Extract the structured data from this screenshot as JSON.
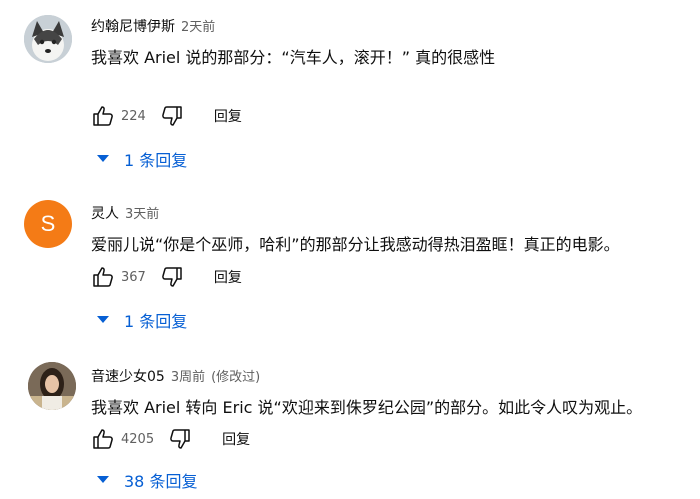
{
  "comments": [
    {
      "author": "约翰尼博伊斯",
      "time": "2天前",
      "edited": "",
      "text": "我喜欢 Ariel 说的那部分：“汽车人，滚开！” 真的很感性",
      "likes": "224",
      "reply_label": "回复",
      "replies_label": "1 条回复",
      "avatar": "husky-dog-photo"
    },
    {
      "author": "灵人",
      "time": "3天前",
      "edited": "",
      "text": "爱丽儿说“你是个巫师，哈利”的那部分让我感动得热泪盈眶！真正的电影。",
      "likes": "367",
      "reply_label": "回复",
      "replies_label": "1 条回复",
      "avatar_letter": "S",
      "avatar_color": "#f47b16"
    },
    {
      "author": "音速少女05",
      "time": "3周前",
      "edited": "(修改过)",
      "text": "我喜欢 Ariel 转向 Eric 说“欢迎来到侏罗纪公园”的部分。如此令人叹为观止。",
      "likes": "4205",
      "reply_label": "回复",
      "replies_label": "38 条回复",
      "avatar": "person-photo"
    }
  ],
  "colors": {
    "link": "#065fd4",
    "meta": "#606060",
    "text": "#0f0f0f"
  },
  "icons": [
    "thumbs-up-icon",
    "thumbs-down-icon",
    "chevron-down-icon"
  ]
}
